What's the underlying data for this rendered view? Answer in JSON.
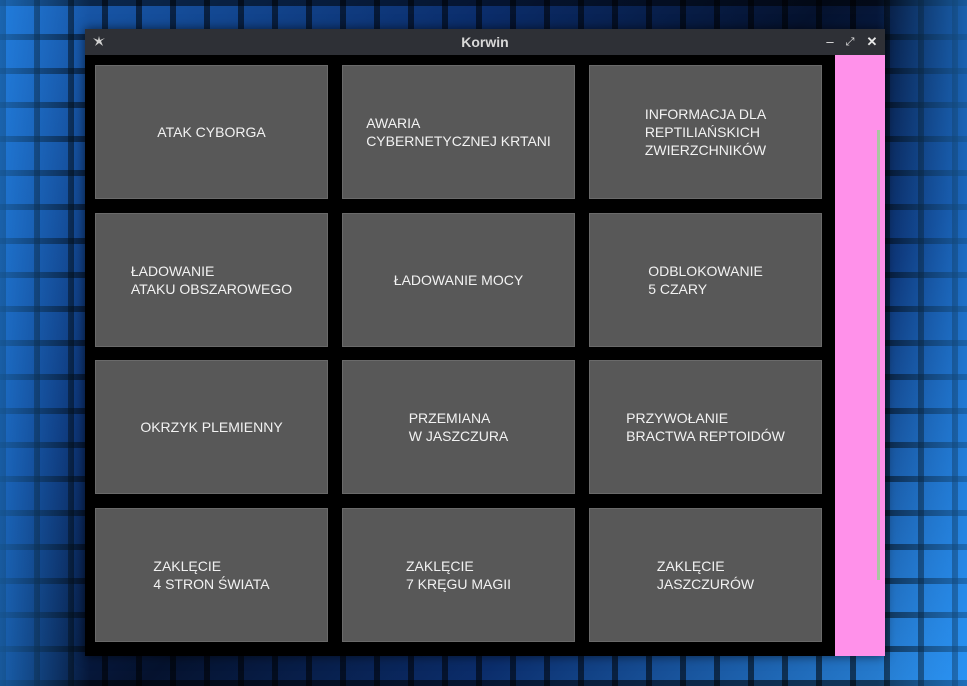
{
  "window": {
    "title": "Korwin"
  },
  "titlebar": {
    "app_icon": "kivy-icon",
    "minimize": "–",
    "maximize": "⤢",
    "close": "✕"
  },
  "buttons": [
    [
      "ATAK CYBORGA",
      "AWARIA\nCYBERNETYCZNEJ KRTANI",
      "INFORMACJA DLA\nREPTILIAŃSKICH\nZWIERZCHNIKÓW"
    ],
    [
      "ŁADOWANIE\nATAKU OBSZAROWEGO",
      "ŁADOWANIE MOCY",
      "ODBLOKOWANIE\n5 CZARY"
    ],
    [
      "OKRZYK PLEMIENNY",
      "PRZEMIANA\nW JASZCZURA",
      "PRZYWOŁANIE\nBRACTWA REPTOIDÓW"
    ],
    [
      "ZAKLĘCIE\n4 STRON ŚWIATA",
      "ZAKLĘCIE\n7 KRĘGU MAGII",
      "ZAKLĘCIE\nJASZCZURÓW"
    ]
  ],
  "colors": {
    "tile_bg": "#585858",
    "side_panel": "#ff91ea",
    "titlebar": "#2e3036"
  }
}
